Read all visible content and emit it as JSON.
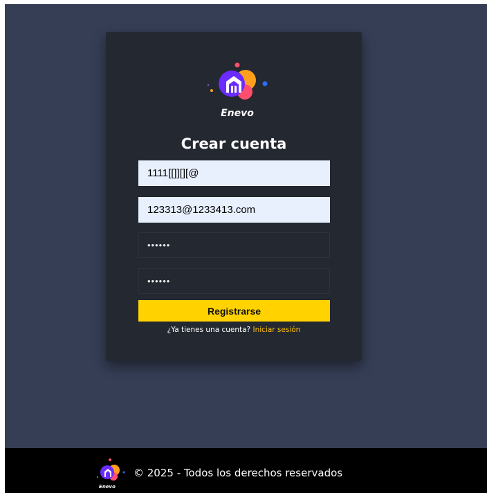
{
  "brand": {
    "name": "Enevo",
    "colors": {
      "page_bg": "#353e55",
      "card_bg": "#232831",
      "accent": "#ffd200",
      "link": "#ffc107",
      "footer_bg": "#000000"
    },
    "logo_icon": "house-bubble-logo-icon"
  },
  "form": {
    "title": "Crear cuenta",
    "username_value": "1111[[]][][@",
    "email_value": "123313@1233413.com",
    "password_value": "••••••",
    "confirm_password_value": "••••••",
    "submit_label": "Registrarse",
    "login_prompt": "¿Ya tienes una cuenta?",
    "login_link": "Iniciar sesión"
  },
  "footer": {
    "logo_text": "Enevo",
    "copyright": "© 2025 - Todos los derechos reservados"
  }
}
